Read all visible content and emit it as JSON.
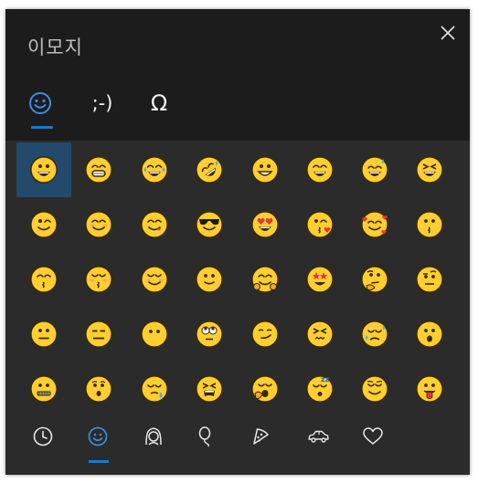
{
  "window": {
    "title": "이모지",
    "close_label": "close"
  },
  "tabs": [
    {
      "id": "emoji",
      "glyph": "☺",
      "active": true
    },
    {
      "id": "kaomoji",
      "glyph": ";-)",
      "active": false
    },
    {
      "id": "symbols",
      "glyph": "Ω",
      "active": false
    }
  ],
  "emoji_grid": [
    [
      "grinning",
      "beaming",
      "joy",
      "rofl",
      "grin-wide",
      "smile",
      "sweat-smile",
      "laughing"
    ],
    [
      "wink",
      "blush-smile",
      "yum",
      "sunglasses",
      "heart-eyes",
      "kissing-heart",
      "smiling-hearts",
      "kissing"
    ],
    [
      "kissing-smiling-eyes",
      "kissing-closed-eyes",
      "relaxed",
      "slight-smile",
      "hugging",
      "star-struck",
      "thinking",
      "raised-eyebrow"
    ],
    [
      "neutral",
      "expressionless",
      "no-mouth",
      "rolling-eyes",
      "smirk",
      "persevering",
      "disappointed-relieved",
      "open-mouth"
    ],
    [
      "zipper-mouth",
      "hushed",
      "sleepy",
      "tired",
      "yawning",
      "sleeping",
      "relieved",
      "tongue-out"
    ]
  ],
  "selected_cell": {
    "row": 0,
    "col": 0
  },
  "categories": [
    {
      "id": "recent",
      "icon": "clock-icon",
      "active": false
    },
    {
      "id": "smileys",
      "icon": "smiley-icon",
      "active": true
    },
    {
      "id": "people",
      "icon": "person-icon",
      "active": false
    },
    {
      "id": "celebration",
      "icon": "balloon-icon",
      "active": false
    },
    {
      "id": "food",
      "icon": "pizza-icon",
      "active": false
    },
    {
      "id": "travel",
      "icon": "car-icon",
      "active": false
    },
    {
      "id": "symbols",
      "icon": "heart-icon",
      "active": false
    }
  ],
  "colors": {
    "panel_bg": "#1c1c1c",
    "grid_bg": "#2b2b2b",
    "accent": "#1a78d2",
    "selection": "#234a6c",
    "emoji_face": "#ffce31",
    "emoji_outline": "#3a2a00"
  }
}
